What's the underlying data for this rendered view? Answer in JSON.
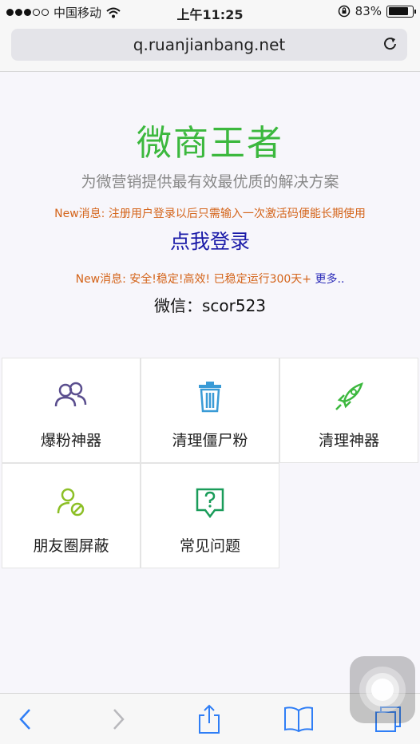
{
  "status_bar": {
    "carrier": "中国移动",
    "time": "上午11:25",
    "battery": "83%",
    "battery_level": 0.83
  },
  "browser": {
    "url": "q.ruanjianbang.net"
  },
  "page": {
    "title": "微商王者",
    "subtitle": "为微营销提供最有效最优质的解决方案",
    "notice1": "New消息: 注册用户登录以后只需输入一次激活码便能长期使用",
    "login_link": "点我登录",
    "notice2_text": "New消息: 安全!稳定!高效! 已稳定运行300天+ ",
    "notice2_link": "更多..",
    "wechat": "微信：scor523"
  },
  "features": [
    {
      "label": "爆粉神器",
      "icon": "users-icon",
      "color": "#5a4e8e"
    },
    {
      "label": "清理僵尸粉",
      "icon": "trash-icon",
      "color": "#3a9bd6"
    },
    {
      "label": "清理神器",
      "icon": "rocket-icon",
      "color": "#3cb83e"
    },
    {
      "label": "朋友圈屏蔽",
      "icon": "user-block-icon",
      "color": "#8cbf26"
    },
    {
      "label": "常见问题",
      "icon": "question-bubble-icon",
      "color": "#1a9c5a"
    }
  ],
  "toolbar": {
    "tint": "#2f7ef6"
  }
}
